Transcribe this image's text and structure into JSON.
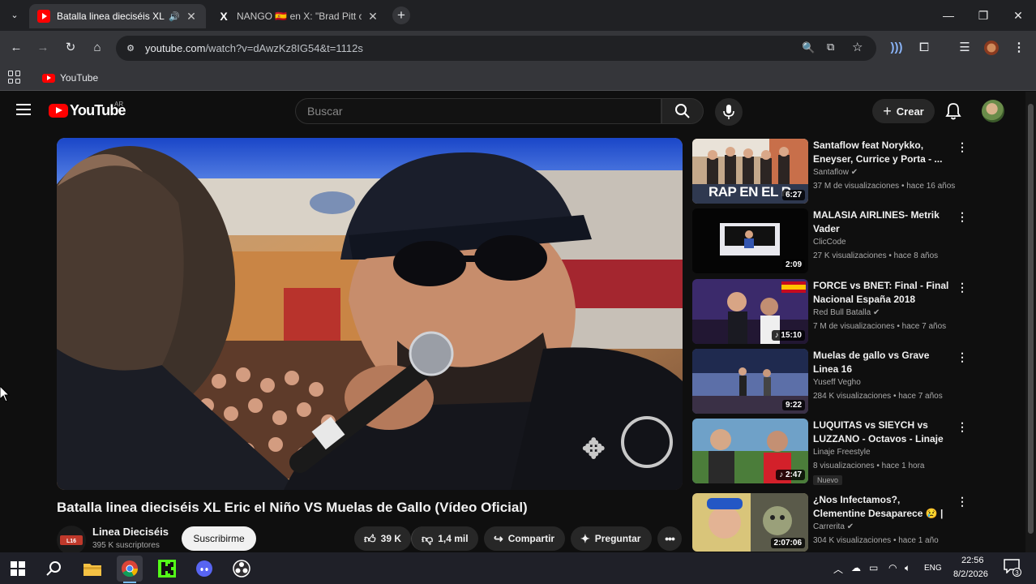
{
  "browser": {
    "tabs": [
      {
        "title": "Batalla linea dieciséis XL Eric",
        "active": true,
        "favicon": "youtube-icon"
      },
      {
        "title": "NANGO 🇪🇸 en X: \"Brad Pitt con",
        "active": false,
        "favicon": "x-icon"
      }
    ],
    "url_host": "youtube.com",
    "url_path": "/watch?v=dAwzKz8IG54&t=1112s",
    "bookmarks": [
      {
        "label": "YouTube",
        "icon": "youtube-icon"
      }
    ]
  },
  "youtube": {
    "logo_text": "YouTube",
    "country_code": "AR",
    "search_placeholder": "Buscar",
    "create_label": "Crear",
    "video": {
      "title": "Batalla linea dieciséis XL Eric el Niño VS Muelas de Gallo (Vídeo Oficial)",
      "channel": "Linea Dieciséis",
      "subscribers": "395 K suscriptores",
      "subscribe_label": "Suscribirme",
      "likes": "39 K",
      "dislikes": "1,4 mil",
      "share_label": "Compartir",
      "ask_label": "Preguntar"
    },
    "recommendations": [
      {
        "title": "Santaflow feat Norykko, Eneyser, Currice y Porta - ...",
        "channel": "Santaflow",
        "verified": true,
        "meta": "37 M de visualizaciones • hace 16 años",
        "duration": "6:27",
        "thumb_text": "RAP EN EL R"
      },
      {
        "title": "MALASIA AIRLINES-  Metrik Vader",
        "channel": "ClicCode",
        "verified": false,
        "meta": "27 K visualizaciones • hace 8 años",
        "duration": "2:09"
      },
      {
        "title": "FORCE vs BNET: Final - Final Nacional España 2018",
        "channel": "Red Bull Batalla",
        "verified": true,
        "meta": "7 M de visualizaciones • hace 7 años",
        "duration": "15:10",
        "music": true
      },
      {
        "title": "Muelas de gallo vs Grave Linea 16",
        "channel": "Yuseff Vegho",
        "verified": false,
        "meta": "284 K visualizaciones • hace 7 años",
        "duration": "9:22"
      },
      {
        "title": "LUQUITAS vs SIEYCH vs LUZZANO - Octavos - Linaje ...",
        "channel": "Linaje Freestyle",
        "verified": false,
        "meta": "8 visualizaciones • hace 1 hora",
        "duration": "2:47",
        "music": true,
        "badge": "Nuevo"
      },
      {
        "title": "¿Nos Infectamos?, Clementine Desaparece 😢 | The Walking ...",
        "channel": "Carrerita",
        "verified": true,
        "meta": "304 K visualizaciones • hace 1 año",
        "duration": "2:07:06"
      }
    ]
  },
  "taskbar": {
    "language": "ENG",
    "time": "22:56",
    "date": "8/2/2026",
    "notifications": "3"
  }
}
